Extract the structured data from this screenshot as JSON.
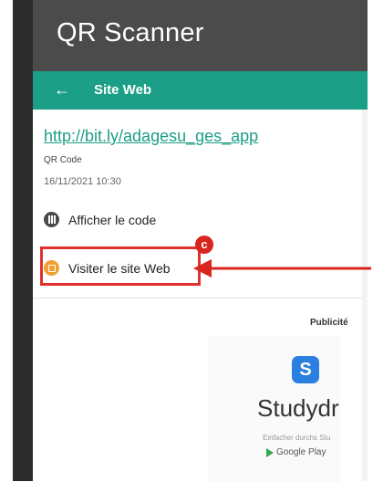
{
  "app": {
    "title": "QR Scanner"
  },
  "toolbar": {
    "back_icon": "arrow-left-icon",
    "back_glyph": "←",
    "title": "Site Web"
  },
  "result": {
    "url": "http://bit.ly/adagesu_ges_app",
    "type": "QR Code",
    "datetime": "16/11/2021 10:30"
  },
  "actions": [
    {
      "label": "Afficher le code",
      "icon": "barcode-icon"
    },
    {
      "label": "Visiter le site Web",
      "icon": "globe-icon"
    }
  ],
  "annotation": {
    "badge": "c",
    "color": "#d8261f"
  },
  "ad": {
    "label": "Publicité",
    "logo": "S",
    "name": "Studydri",
    "tagline": "Einfacher durchs Stu",
    "store": "Google Play"
  },
  "colors": {
    "accent": "#1b9f87",
    "titlebar": "#4b4b4b",
    "highlight": "#e03030"
  }
}
